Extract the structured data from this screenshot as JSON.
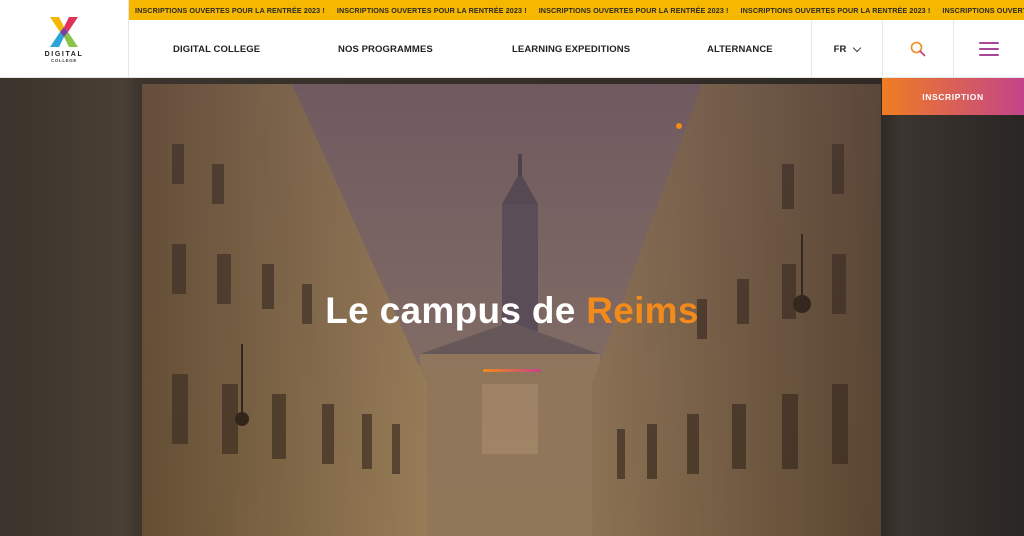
{
  "brand": {
    "name": "DIGITAL",
    "sub": "COLLEGE"
  },
  "ticker": {
    "items": [
      "INSCRIPTIONS OUVERTES POUR LA RENTRÉE 2023 !",
      "INSCRIPTIONS OUVERTES POUR LA RENTRÉE 2023 !",
      "INSCRIPTIONS OUVERTES POUR LA RENTRÉE 2023 !",
      "INSCRIPTIONS OUVERTES POUR LA RENTRÉE 2023 !",
      "INSCRIPTIONS OUVERTES POUR LA RENTRÉE 2023 !"
    ]
  },
  "nav": {
    "items": [
      {
        "label": "DIGITAL COLLEGE"
      },
      {
        "label": "NOS PROGRAMMES"
      },
      {
        "label": "LEARNING EXPEDITIONS"
      },
      {
        "label": "ALTERNANCE"
      }
    ],
    "lang": "FR"
  },
  "cta": {
    "label": "INSCRIPTION"
  },
  "hero": {
    "title_prefix": "Le campus de ",
    "title_accent": "Reims"
  },
  "colors": {
    "ticker": "#f5b700",
    "accent_orange": "#f28a1c",
    "accent_purple": "#a9469a"
  },
  "icons": [
    "logo-mark-icon",
    "chevron-down-icon",
    "search-icon",
    "hamburger-menu-icon"
  ]
}
